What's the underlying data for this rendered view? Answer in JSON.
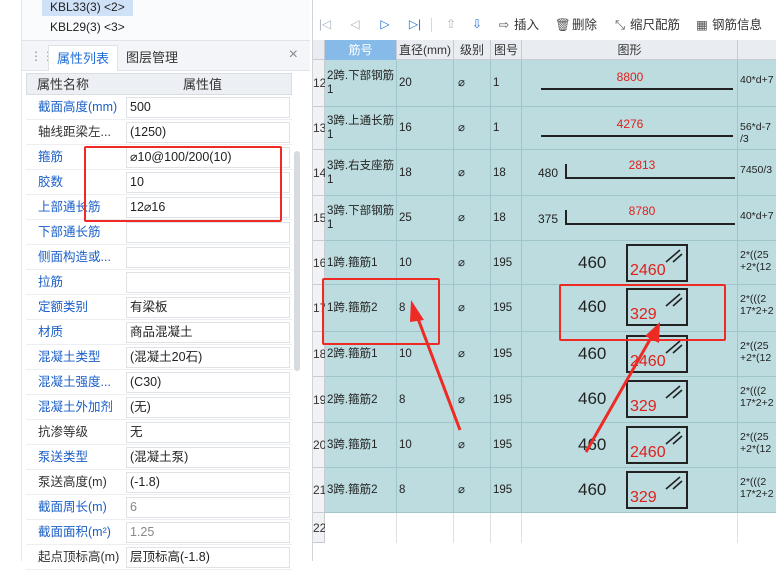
{
  "tree": {
    "items": [
      {
        "label": "KBL33(3)  <2>",
        "selected": true
      },
      {
        "label": "KBL29(3)  <3>",
        "selected": false
      }
    ]
  },
  "property_panel": {
    "tabs": [
      {
        "label": "属性列表",
        "active": true
      },
      {
        "label": "图层管理",
        "active": false
      }
    ],
    "close_label": "×",
    "header": {
      "name": "属性名称",
      "value": "属性值"
    },
    "rows": [
      {
        "num": "",
        "name": "截面高度(mm)",
        "value": "500",
        "style": "blue"
      },
      {
        "num": "",
        "name": "轴线距梁左...",
        "value": "(1250)",
        "style": "dark"
      },
      {
        "num": "",
        "name": "箍筋",
        "value": "⌀10@100/200(10)",
        "style": "blue"
      },
      {
        "num": "",
        "name": "胶数",
        "value": "10",
        "style": "blue"
      },
      {
        "num": "",
        "name": "上部通长筋",
        "value": "12⌀16",
        "style": "blue"
      },
      {
        "num": "",
        "name": "下部通长筋",
        "value": "",
        "style": "blue"
      },
      {
        "num": "",
        "name": "侧面构造或...",
        "value": "",
        "style": "blue"
      },
      {
        "num": "",
        "name": "拉筋",
        "value": "",
        "style": "blue"
      },
      {
        "num": "",
        "name": "定额类别",
        "value": "有梁板",
        "style": "blue"
      },
      {
        "num": "",
        "name": "材质",
        "value": "商品混凝土",
        "style": "blue"
      },
      {
        "num": "",
        "name": "混凝土类型",
        "value": "(混凝土20石)",
        "style": "blue"
      },
      {
        "num": "",
        "name": "混凝土强度...",
        "value": "(C30)",
        "style": "blue"
      },
      {
        "num": "",
        "name": "混凝土外加剂",
        "value": "(无)",
        "style": "blue"
      },
      {
        "num": "",
        "name": "抗渗等级",
        "value": "无",
        "style": "dark"
      },
      {
        "num": "",
        "name": "泵送类型",
        "value": "(混凝土泵)",
        "style": "blue"
      },
      {
        "num": "",
        "name": "泵送高度(m)",
        "value": "(-1.8)",
        "style": "dark"
      },
      {
        "num": "",
        "name": "截面周长(m)",
        "value": "6",
        "style": "blue",
        "gray": true
      },
      {
        "num": "",
        "name": "截面面积(m²)",
        "value": "1.25",
        "style": "blue",
        "gray": true
      },
      {
        "num": "",
        "name": "起点顶标高(m)",
        "value": "层顶标高(-1.8)",
        "style": "dark"
      }
    ]
  },
  "toolbar": {
    "insert_label": "插入",
    "delete_label": "删除",
    "scale_label": "缩尺配筋",
    "rebar_info_label": "钢筋信息"
  },
  "grid": {
    "headers": [
      "筋号",
      "直径(mm)",
      "级别",
      "图号",
      "图形"
    ],
    "rows": [
      {
        "num": "12",
        "name": "2跨.下部钢筋1",
        "dia": "20",
        "grade": "⌀",
        "fig": "1",
        "shape": "straight",
        "length": "8800",
        "formula": "40*d+7"
      },
      {
        "num": "13",
        "name": "3跨.上通长筋1",
        "dia": "16",
        "grade": "⌀",
        "fig": "1",
        "shape": "straight",
        "length": "4276",
        "formula": "56*d-7 /3"
      },
      {
        "num": "14",
        "name": "3跨.右支座筋1",
        "dia": "18",
        "grade": "⌀",
        "fig": "18",
        "shape": "hook",
        "hook": "480",
        "length": "2813",
        "formula": "7450/3"
      },
      {
        "num": "15",
        "name": "3跨.下部钢筋1",
        "dia": "25",
        "grade": "⌀",
        "fig": "18",
        "shape": "hook",
        "hook": "375",
        "length": "8780",
        "formula": "40*d+7"
      },
      {
        "num": "16",
        "name": "1跨.箍筋1",
        "dia": "10",
        "grade": "⌀",
        "fig": "195",
        "shape": "stirrup",
        "w": "460",
        "h": "2460",
        "formula": "2*((25 +2*(12"
      },
      {
        "num": "17",
        "name": "1跨.箍筋2",
        "dia": "8",
        "grade": "⌀",
        "fig": "195",
        "shape": "stirrup",
        "w": "460",
        "h": "329",
        "formula": "2*(((2 17*2+2"
      },
      {
        "num": "18",
        "name": "2跨.箍筋1",
        "dia": "10",
        "grade": "⌀",
        "fig": "195",
        "shape": "stirrup",
        "w": "460",
        "h": "2460",
        "formula": "2*((25 +2*(12"
      },
      {
        "num": "19",
        "name": "2跨.箍筋2",
        "dia": "8",
        "grade": "⌀",
        "fig": "195",
        "shape": "stirrup",
        "w": "460",
        "h": "329",
        "formula": "2*(((2 17*2+2"
      },
      {
        "num": "20",
        "name": "3跨.箍筋1",
        "dia": "10",
        "grade": "⌀",
        "fig": "195",
        "shape": "stirrup",
        "w": "460",
        "h": "2460",
        "formula": "2*((25 +2*(12"
      },
      {
        "num": "21",
        "name": "3跨.箍筋2",
        "dia": "8",
        "grade": "⌀",
        "fig": "195",
        "shape": "stirrup",
        "w": "460",
        "h": "329",
        "formula": "2*(((2 17*2+2"
      },
      {
        "num": "22",
        "name": "",
        "dia": "",
        "grade": "",
        "fig": "",
        "shape": "empty"
      }
    ]
  },
  "colors": {
    "accent": "#1f6fd8",
    "row_bg": "#bcdcdf",
    "annotation": "#ee2a24",
    "header_selected": "#86bbe9"
  }
}
